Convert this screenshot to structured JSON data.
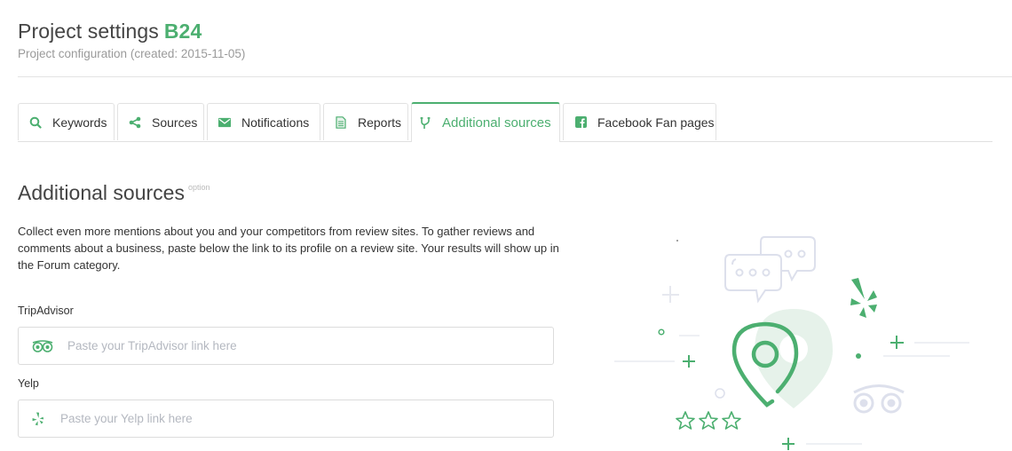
{
  "header": {
    "title": "Project settings",
    "project_name": "B24",
    "subtitle": "Project configuration (created: 2015-11-05)"
  },
  "tabs": [
    {
      "label": "Keywords",
      "icon": "search-icon",
      "active": false
    },
    {
      "label": "Sources",
      "icon": "share-icon",
      "active": false
    },
    {
      "label": "Notifications",
      "icon": "envelope-icon",
      "active": false
    },
    {
      "label": "Reports",
      "icon": "document-icon",
      "active": false
    },
    {
      "label": "Additional sources",
      "icon": "branch-icon",
      "active": true
    },
    {
      "label": "Facebook Fan pages",
      "icon": "facebook-icon",
      "active": false
    }
  ],
  "section": {
    "title": "Additional sources",
    "badge": "option",
    "description": "Collect even more mentions about you and your competitors from review sites. To gather reviews and comments about a business, paste below the link to its profile on a review site. Your results will show up in the Forum category."
  },
  "fields": [
    {
      "label": "TripAdvisor",
      "icon": "tripadvisor-icon",
      "value": "",
      "placeholder": "Paste your TripAdvisor link here"
    },
    {
      "label": "Yelp",
      "icon": "yelp-icon",
      "value": "",
      "placeholder": "Paste your Yelp link here"
    }
  ],
  "colors": {
    "accent": "#4caf70",
    "accent_light": "#e6f2ea",
    "muted_illustration": "#dde0ec"
  }
}
